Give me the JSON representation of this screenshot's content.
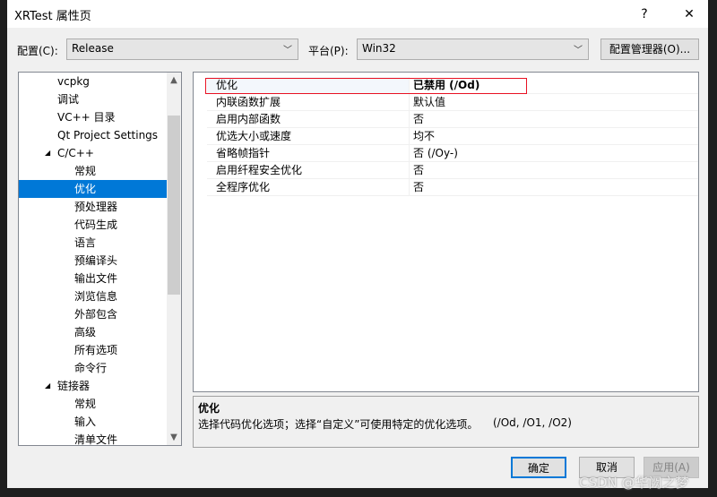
{
  "window": {
    "title": "XRTest 属性页",
    "help": "?",
    "close": "✕"
  },
  "config": {
    "label": "配置(C):",
    "value": "Release",
    "platform_label": "平台(P):",
    "platform_value": "Win32",
    "manager_button": "配置管理器(O)..."
  },
  "tree": {
    "items": [
      {
        "label": "vcpkg",
        "level": 1
      },
      {
        "label": "调试",
        "level": 1
      },
      {
        "label": "VC++ 目录",
        "level": 1
      },
      {
        "label": "Qt Project Settings",
        "level": 1
      },
      {
        "label": "C/C++",
        "level": 1,
        "expanded": true
      },
      {
        "label": "常规",
        "level": 2
      },
      {
        "label": "优化",
        "level": 2,
        "selected": true
      },
      {
        "label": "预处理器",
        "level": 2
      },
      {
        "label": "代码生成",
        "level": 2
      },
      {
        "label": "语言",
        "level": 2
      },
      {
        "label": "预编译头",
        "level": 2
      },
      {
        "label": "输出文件",
        "level": 2
      },
      {
        "label": "浏览信息",
        "level": 2
      },
      {
        "label": "外部包含",
        "level": 2
      },
      {
        "label": "高级",
        "level": 2
      },
      {
        "label": "所有选项",
        "level": 2
      },
      {
        "label": "命令行",
        "level": 2
      },
      {
        "label": "链接器",
        "level": 1,
        "expanded": true
      },
      {
        "label": "常规",
        "level": 2
      },
      {
        "label": "输入",
        "level": 2
      },
      {
        "label": "清单文件",
        "level": 2
      }
    ]
  },
  "properties": [
    {
      "name": "优化",
      "value": "已禁用 (/Od)",
      "bold": true
    },
    {
      "name": "内联函数扩展",
      "value": "默认值"
    },
    {
      "name": "启用内部函数",
      "value": "否"
    },
    {
      "name": "优选大小或速度",
      "value": "均不"
    },
    {
      "name": "省略帧指针",
      "value": "否 (/Oy-)"
    },
    {
      "name": "启用纤程安全优化",
      "value": "否"
    },
    {
      "name": "全程序优化",
      "value": "否"
    }
  ],
  "description": {
    "title": "优化",
    "text": "选择代码优化选项；选择“自定义”可使用特定的优化选项。",
    "switches": "(/Od, /O1, /O2)"
  },
  "buttons": {
    "ok": "确定",
    "cancel": "取消",
    "apply": "应用(A)"
  },
  "watermark": "CSDN @华阙之梦",
  "colors": {
    "selection": "#0078d7",
    "highlight_box": "#e81123"
  }
}
